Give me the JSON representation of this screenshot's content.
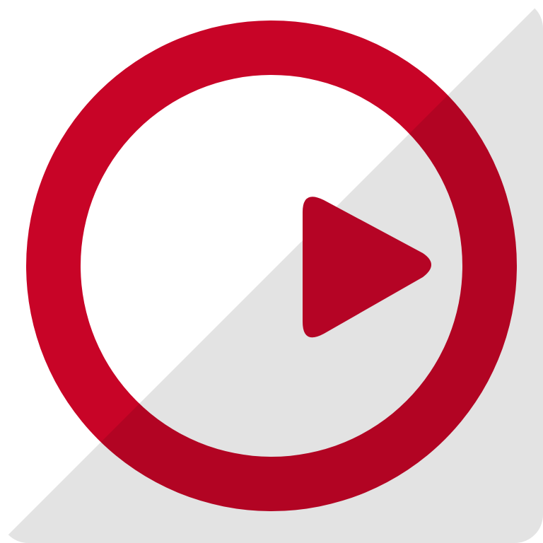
{
  "app_icon": {
    "icon": "play-icon",
    "colors": {
      "tile_light": "#ffffff",
      "tile_shade": "#e3e3e3",
      "ring_light": "#c80427",
      "ring_shade": "#b20423",
      "play_triangle": "#b50425"
    }
  }
}
